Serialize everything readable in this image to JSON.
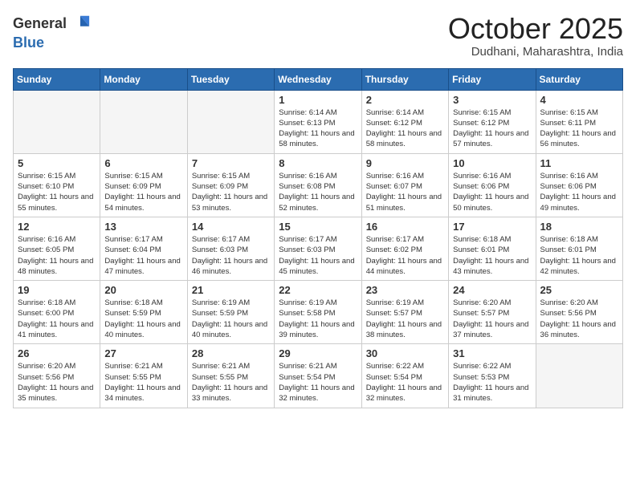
{
  "header": {
    "logo_general": "General",
    "logo_blue": "Blue",
    "month_title": "October 2025",
    "location": "Dudhani, Maharashtra, India"
  },
  "days_of_week": [
    "Sunday",
    "Monday",
    "Tuesday",
    "Wednesday",
    "Thursday",
    "Friday",
    "Saturday"
  ],
  "weeks": [
    [
      {
        "day": "",
        "info": ""
      },
      {
        "day": "",
        "info": ""
      },
      {
        "day": "",
        "info": ""
      },
      {
        "day": "1",
        "info": "Sunrise: 6:14 AM\nSunset: 6:13 PM\nDaylight: 11 hours\nand 58 minutes."
      },
      {
        "day": "2",
        "info": "Sunrise: 6:14 AM\nSunset: 6:12 PM\nDaylight: 11 hours\nand 58 minutes."
      },
      {
        "day": "3",
        "info": "Sunrise: 6:15 AM\nSunset: 6:12 PM\nDaylight: 11 hours\nand 57 minutes."
      },
      {
        "day": "4",
        "info": "Sunrise: 6:15 AM\nSunset: 6:11 PM\nDaylight: 11 hours\nand 56 minutes."
      }
    ],
    [
      {
        "day": "5",
        "info": "Sunrise: 6:15 AM\nSunset: 6:10 PM\nDaylight: 11 hours\nand 55 minutes."
      },
      {
        "day": "6",
        "info": "Sunrise: 6:15 AM\nSunset: 6:09 PM\nDaylight: 11 hours\nand 54 minutes."
      },
      {
        "day": "7",
        "info": "Sunrise: 6:15 AM\nSunset: 6:09 PM\nDaylight: 11 hours\nand 53 minutes."
      },
      {
        "day": "8",
        "info": "Sunrise: 6:16 AM\nSunset: 6:08 PM\nDaylight: 11 hours\nand 52 minutes."
      },
      {
        "day": "9",
        "info": "Sunrise: 6:16 AM\nSunset: 6:07 PM\nDaylight: 11 hours\nand 51 minutes."
      },
      {
        "day": "10",
        "info": "Sunrise: 6:16 AM\nSunset: 6:06 PM\nDaylight: 11 hours\nand 50 minutes."
      },
      {
        "day": "11",
        "info": "Sunrise: 6:16 AM\nSunset: 6:06 PM\nDaylight: 11 hours\nand 49 minutes."
      }
    ],
    [
      {
        "day": "12",
        "info": "Sunrise: 6:16 AM\nSunset: 6:05 PM\nDaylight: 11 hours\nand 48 minutes."
      },
      {
        "day": "13",
        "info": "Sunrise: 6:17 AM\nSunset: 6:04 PM\nDaylight: 11 hours\nand 47 minutes."
      },
      {
        "day": "14",
        "info": "Sunrise: 6:17 AM\nSunset: 6:03 PM\nDaylight: 11 hours\nand 46 minutes."
      },
      {
        "day": "15",
        "info": "Sunrise: 6:17 AM\nSunset: 6:03 PM\nDaylight: 11 hours\nand 45 minutes."
      },
      {
        "day": "16",
        "info": "Sunrise: 6:17 AM\nSunset: 6:02 PM\nDaylight: 11 hours\nand 44 minutes."
      },
      {
        "day": "17",
        "info": "Sunrise: 6:18 AM\nSunset: 6:01 PM\nDaylight: 11 hours\nand 43 minutes."
      },
      {
        "day": "18",
        "info": "Sunrise: 6:18 AM\nSunset: 6:01 PM\nDaylight: 11 hours\nand 42 minutes."
      }
    ],
    [
      {
        "day": "19",
        "info": "Sunrise: 6:18 AM\nSunset: 6:00 PM\nDaylight: 11 hours\nand 41 minutes."
      },
      {
        "day": "20",
        "info": "Sunrise: 6:18 AM\nSunset: 5:59 PM\nDaylight: 11 hours\nand 40 minutes."
      },
      {
        "day": "21",
        "info": "Sunrise: 6:19 AM\nSunset: 5:59 PM\nDaylight: 11 hours\nand 40 minutes."
      },
      {
        "day": "22",
        "info": "Sunrise: 6:19 AM\nSunset: 5:58 PM\nDaylight: 11 hours\nand 39 minutes."
      },
      {
        "day": "23",
        "info": "Sunrise: 6:19 AM\nSunset: 5:57 PM\nDaylight: 11 hours\nand 38 minutes."
      },
      {
        "day": "24",
        "info": "Sunrise: 6:20 AM\nSunset: 5:57 PM\nDaylight: 11 hours\nand 37 minutes."
      },
      {
        "day": "25",
        "info": "Sunrise: 6:20 AM\nSunset: 5:56 PM\nDaylight: 11 hours\nand 36 minutes."
      }
    ],
    [
      {
        "day": "26",
        "info": "Sunrise: 6:20 AM\nSunset: 5:56 PM\nDaylight: 11 hours\nand 35 minutes."
      },
      {
        "day": "27",
        "info": "Sunrise: 6:21 AM\nSunset: 5:55 PM\nDaylight: 11 hours\nand 34 minutes."
      },
      {
        "day": "28",
        "info": "Sunrise: 6:21 AM\nSunset: 5:55 PM\nDaylight: 11 hours\nand 33 minutes."
      },
      {
        "day": "29",
        "info": "Sunrise: 6:21 AM\nSunset: 5:54 PM\nDaylight: 11 hours\nand 32 minutes."
      },
      {
        "day": "30",
        "info": "Sunrise: 6:22 AM\nSunset: 5:54 PM\nDaylight: 11 hours\nand 32 minutes."
      },
      {
        "day": "31",
        "info": "Sunrise: 6:22 AM\nSunset: 5:53 PM\nDaylight: 11 hours\nand 31 minutes."
      },
      {
        "day": "",
        "info": ""
      }
    ]
  ]
}
